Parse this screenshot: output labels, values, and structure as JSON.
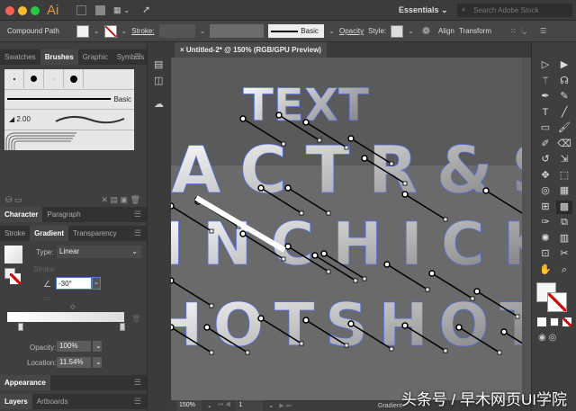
{
  "app": {
    "logo": "Ai",
    "workspace": "Essentials",
    "search_placeholder": "Search Adobe Stock"
  },
  "control": {
    "selection": "Compound Path",
    "stroke_label": "Stroke:",
    "brush": "Basic",
    "opacity_label": "Opacity",
    "style_label": "Style:",
    "align": "Align",
    "transform": "Transform"
  },
  "brushes_panel": {
    "tabs": [
      "Swatches",
      "Brushes",
      "Graphic",
      "Symbols"
    ],
    "active": "Brushes",
    "basic": "Basic",
    "size": "2.00"
  },
  "char_panel": {
    "tabs": [
      "Character",
      "Paragraph"
    ]
  },
  "gradient_panel": {
    "tabs": [
      "Stroke",
      "Gradient",
      "Transparency"
    ],
    "type_label": "Type:",
    "type": "Linear",
    "stroke_label": "Stroke:",
    "angle": "-30°",
    "opacity_label": "Opacity:",
    "opacity": "100%",
    "location_label": "Location:",
    "location": "11.54%"
  },
  "appearance": {
    "tab": "Appearance"
  },
  "layers": {
    "tabs": [
      "Layers",
      "Artboards"
    ]
  },
  "document": {
    "tab": "Untitled-2* @ 150% (RGB/GPU Preview)",
    "words": [
      "TEXT",
      "ACTR&S",
      "INCHICK",
      "HOTSHOT"
    ]
  },
  "status": {
    "zoom": "150%",
    "artboard": "1",
    "tool": "Gradient"
  },
  "watermark": "头条号 / 早木网页UI学院",
  "colors": {
    "selection": "#4f6fe8",
    "bg": "#535353"
  },
  "tools": [
    "direct-selection",
    "selection",
    "magic-wand",
    "lasso",
    "pen",
    "curvature",
    "type",
    "line",
    "rectangle",
    "paintbrush",
    "shaper",
    "eraser",
    "rotate",
    "scale",
    "puppet-warp",
    "free-transform",
    "shape-builder",
    "perspective",
    "mesh",
    "gradient",
    "eyedropper",
    "blend",
    "symbol-sprayer",
    "column-graph",
    "artboard",
    "slice",
    "hand",
    "zoom"
  ]
}
